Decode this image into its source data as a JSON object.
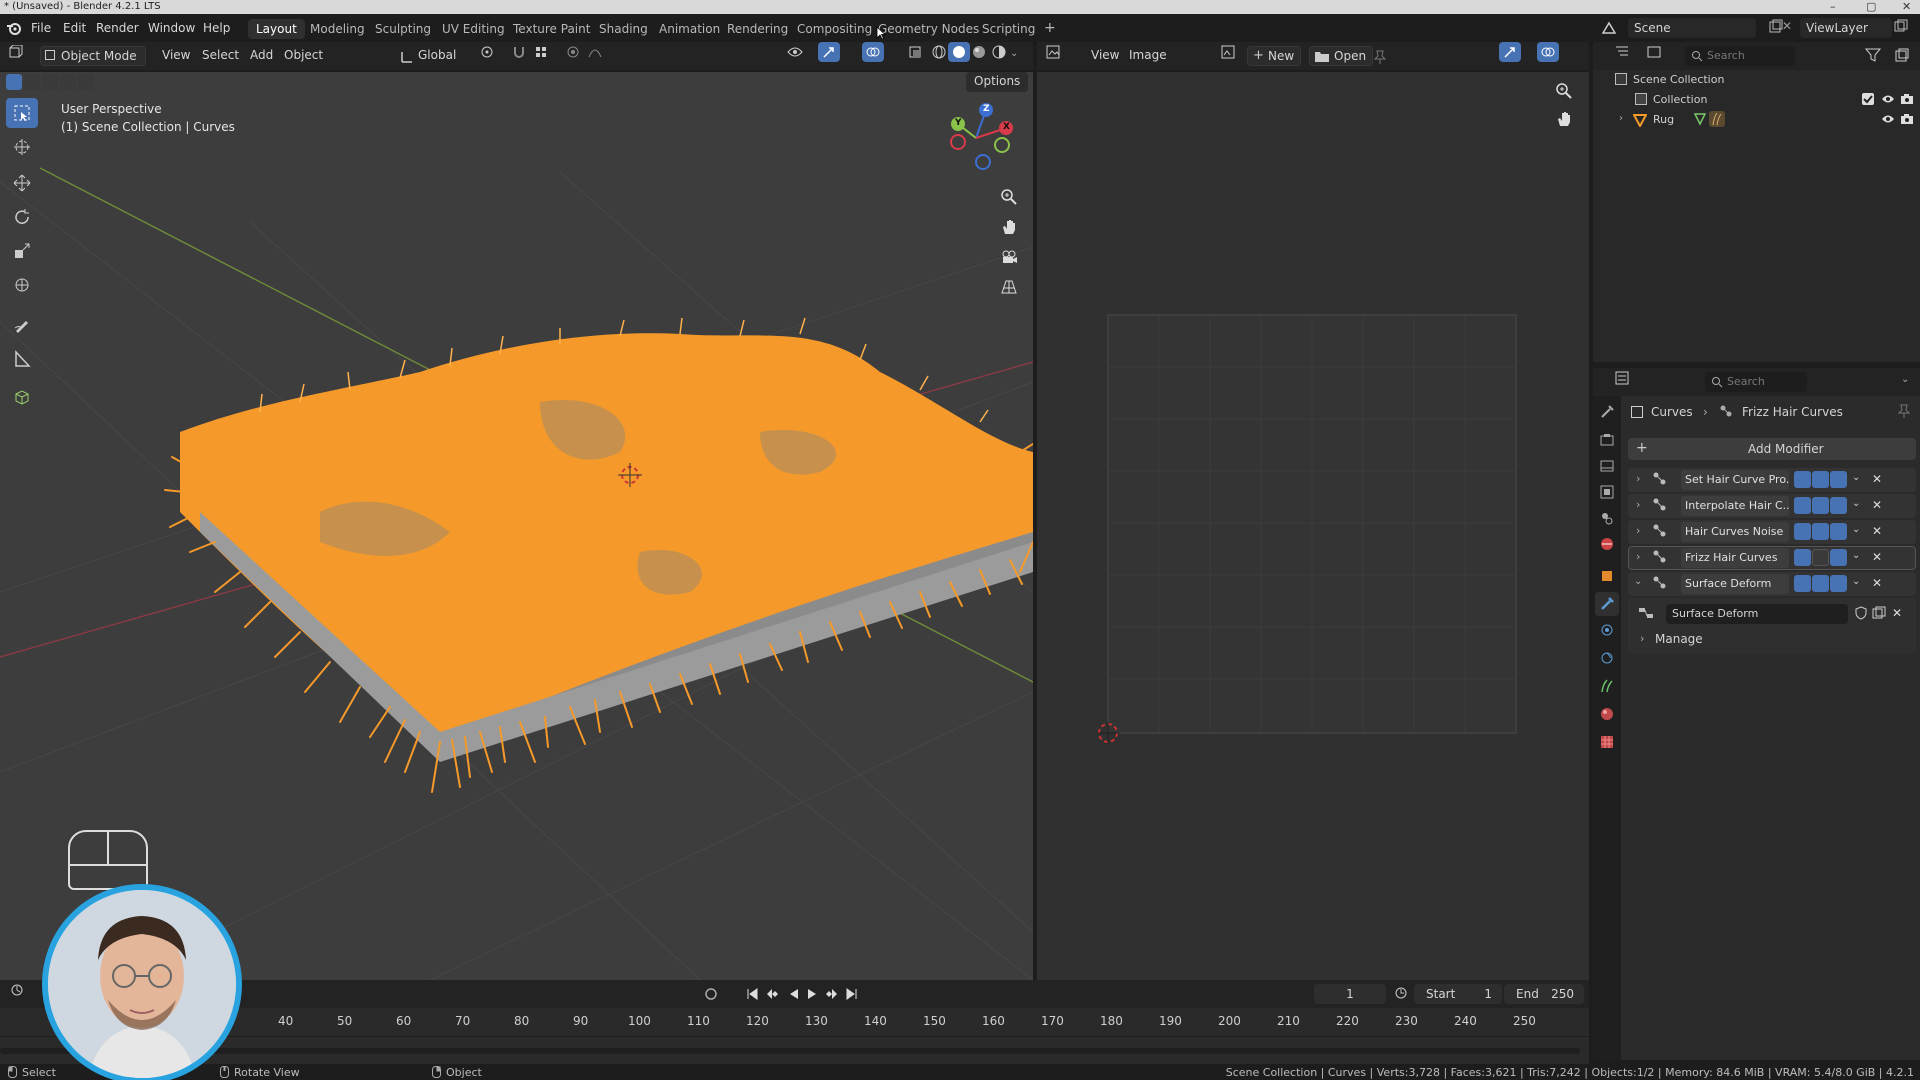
{
  "window": {
    "title": "* (Unsaved) - Blender 4.2.1 LTS"
  },
  "menu": [
    "File",
    "Edit",
    "Render",
    "Window",
    "Help"
  ],
  "workspaces": [
    "Layout",
    "Modeling",
    "Sculpting",
    "UV Editing",
    "Texture Paint",
    "Shading",
    "Animation",
    "Rendering",
    "Compositing",
    "Geometry Nodes",
    "Scripting"
  ],
  "active_workspace": "Layout",
  "scene": {
    "scene_name": "Scene",
    "view_layer": "ViewLayer"
  },
  "viewport_header": {
    "mode": "Object Mode",
    "menus": [
      "View",
      "Select",
      "Add",
      "Object"
    ],
    "orientation": "Global",
    "options": "Options"
  },
  "viewport": {
    "perspective": "User Perspective",
    "collection": "(1) Scene Collection | Curves",
    "gizmo_axes": [
      "Z",
      "Y",
      "X"
    ],
    "object_color": "#f59a2a"
  },
  "image_editor": {
    "menus": [
      "View",
      "Image"
    ],
    "new_label": "New",
    "open_label": "Open"
  },
  "outliner": {
    "search_placeholder": "Search",
    "items": [
      {
        "label": "Scene Collection"
      },
      {
        "label": "Collection"
      },
      {
        "label": "Rug"
      }
    ]
  },
  "properties": {
    "search_placeholder": "Search",
    "breadcrumb": [
      "Curves",
      "Frizz Hair Curves"
    ],
    "add_modifier": "Add Modifier",
    "modifiers": [
      {
        "name": "Set Hair Curve Pro..."
      },
      {
        "name": "Interpolate Hair C..."
      },
      {
        "name": "Hair Curves Noise"
      },
      {
        "name": "Frizz Hair Curves"
      },
      {
        "name": "Surface Deform"
      }
    ],
    "node_group": "Surface Deform",
    "manage": "Manage"
  },
  "timeline": {
    "current_frame": "1",
    "start_label": "Start",
    "start": "1",
    "end_label": "End",
    "end": "250",
    "ticks": [
      "40",
      "50",
      "60",
      "70",
      "80",
      "90",
      "100",
      "110",
      "120",
      "130",
      "140",
      "150",
      "160",
      "170",
      "180",
      "190",
      "200",
      "210",
      "220",
      "230",
      "240",
      "250"
    ]
  },
  "statusbar": {
    "select": "Select",
    "rotate": "Rotate View",
    "object": "Object",
    "stats": "Scene Collection | Curves | Verts:3,728 | Faces:3,621 | Tris:7,242 | Objects:1/2 | Memory: 84.6 MiB | VRAM: 5.4/8.0 GiB | 4.2.1"
  }
}
